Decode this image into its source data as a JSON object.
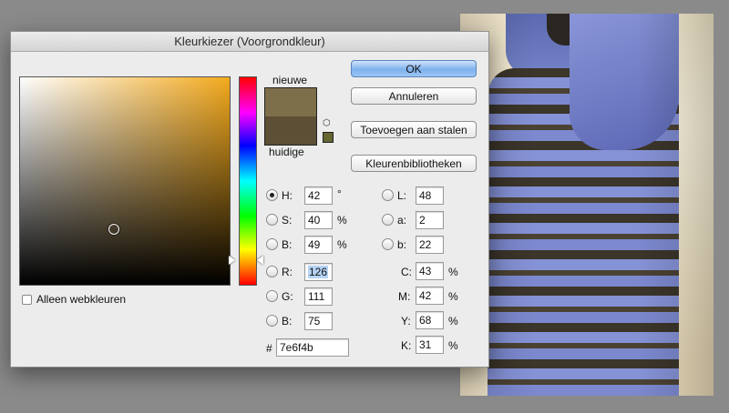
{
  "window": {
    "title": "Kleurkiezer (Voorgrondkleur)"
  },
  "swatch": {
    "new_label": "nieuwe",
    "current_label": "huidige",
    "new_color": "#7e6f4b",
    "current_color": "#5c4f36"
  },
  "buttons": {
    "ok": "OK",
    "cancel": "Annuleren",
    "add_swatch": "Toevoegen aan stalen",
    "libraries": "Kleurenbibliotheken"
  },
  "webcolors_label": "Alleen webkleuren",
  "fields": {
    "H": {
      "label": "H:",
      "value": "42",
      "unit": "°"
    },
    "S": {
      "label": "S:",
      "value": "40",
      "unit": "%"
    },
    "B": {
      "label": "B:",
      "value": "49",
      "unit": "%"
    },
    "R": {
      "label": "R:",
      "value": "126"
    },
    "G": {
      "label": "G:",
      "value": "111"
    },
    "Bl": {
      "label": "B:",
      "value": "75"
    },
    "L": {
      "label": "L:",
      "value": "48"
    },
    "a": {
      "label": "a:",
      "value": "2"
    },
    "b": {
      "label": "b:",
      "value": "22"
    },
    "C": {
      "label": "C:",
      "value": "43",
      "unit": "%"
    },
    "M": {
      "label": "M:",
      "value": "42",
      "unit": "%"
    },
    "Y": {
      "label": "Y:",
      "value": "68",
      "unit": "%"
    },
    "K": {
      "label": "K:",
      "value": "31",
      "unit": "%"
    },
    "hex": {
      "label": "#",
      "value": "7e6f4b"
    }
  },
  "colors": {
    "hue_base": "#f3aa1e",
    "accent": "#7fb2ee"
  }
}
